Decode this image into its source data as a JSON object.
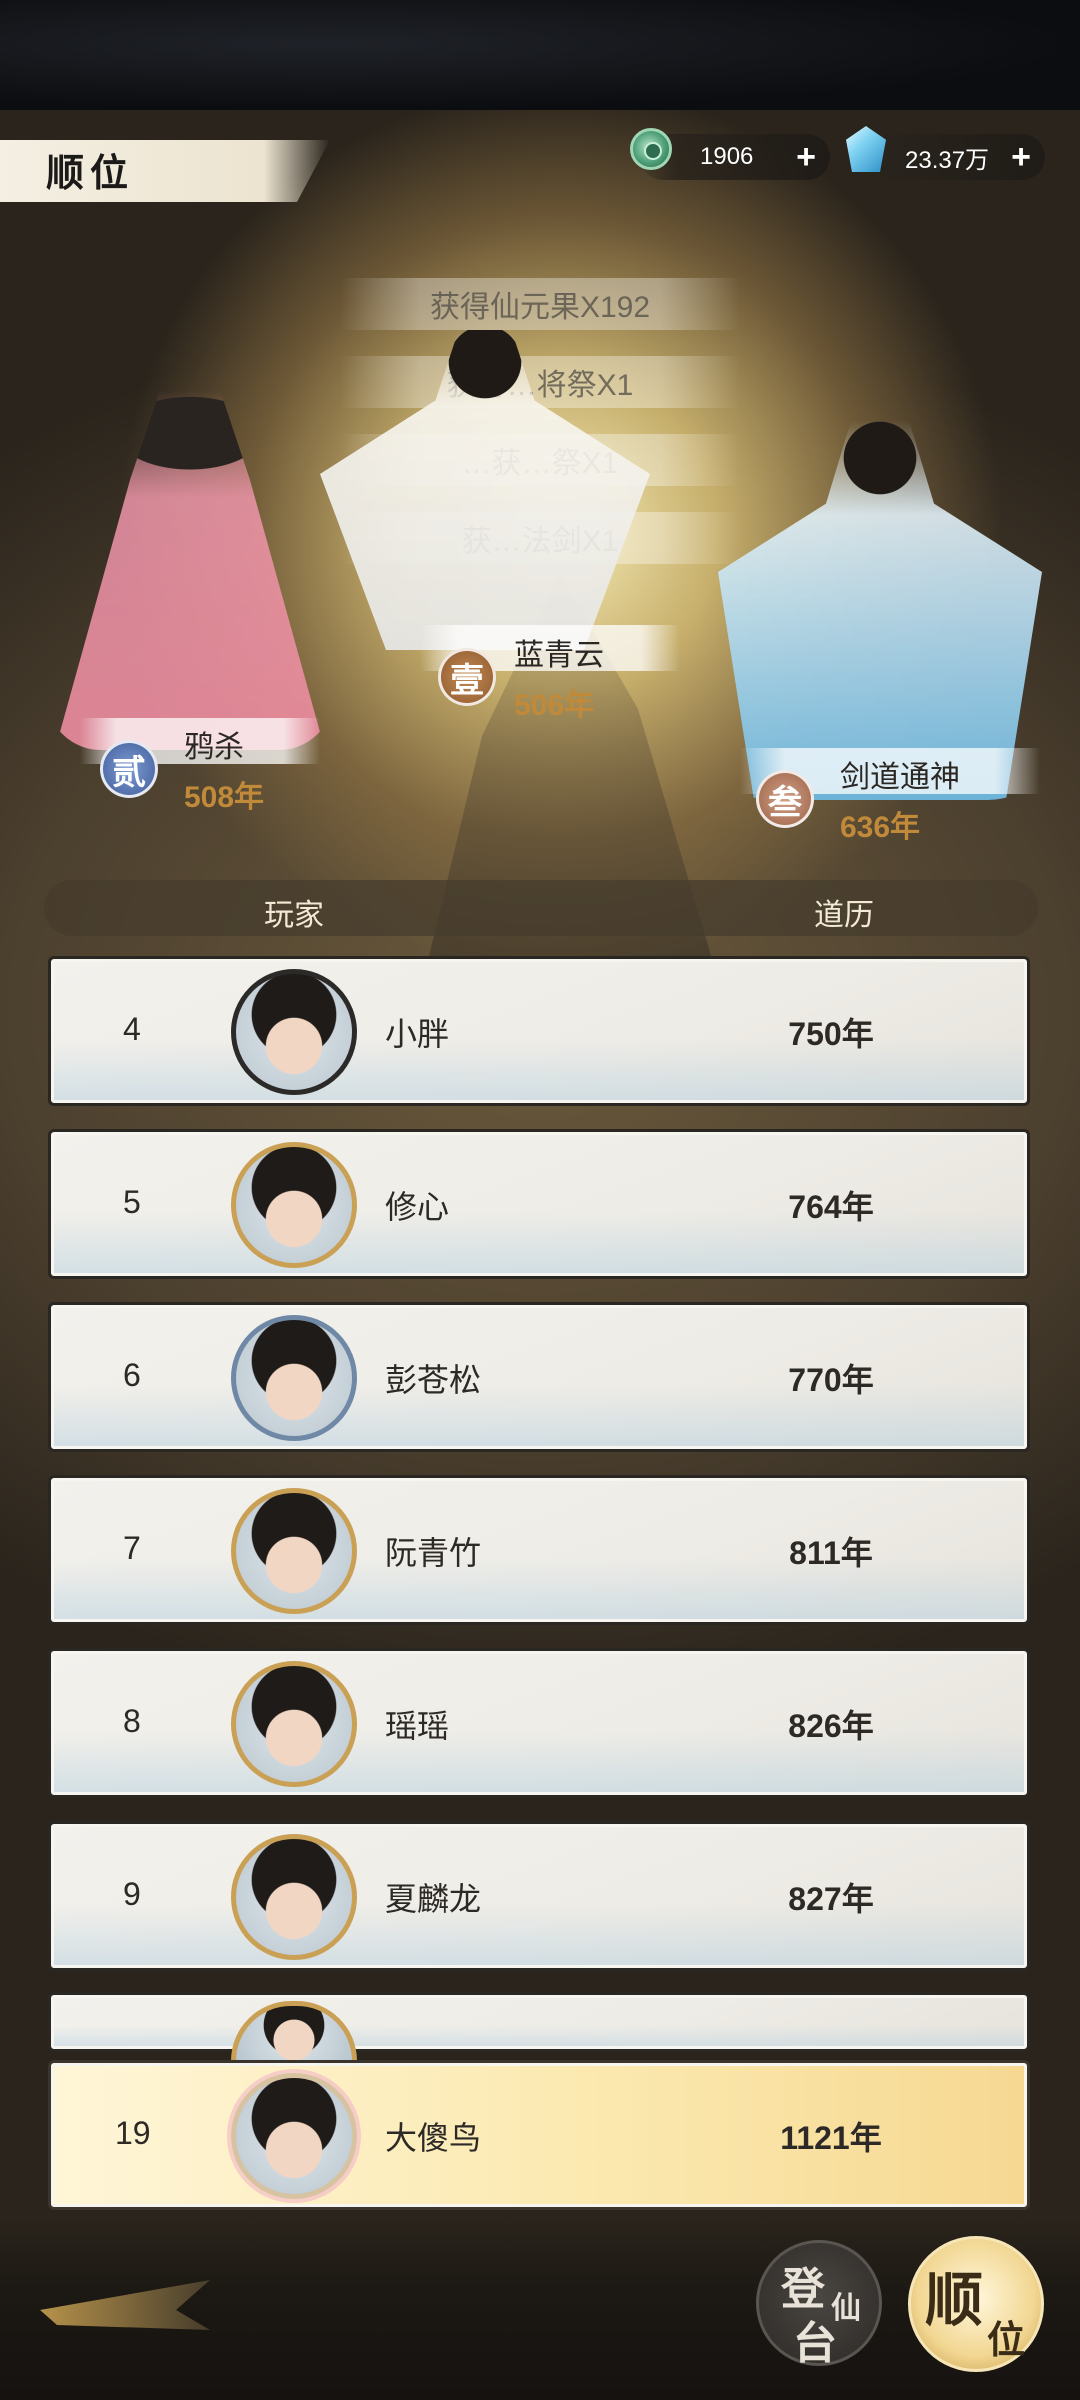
{
  "header": {
    "title": "顺位",
    "currency": [
      {
        "icon": "jade-coin-icon",
        "value": "1906",
        "plus": "+"
      },
      {
        "icon": "spirit-gem-icon",
        "value": "23.37万",
        "plus": "+"
      }
    ]
  },
  "rewards": [
    "获得仙元果X192",
    "获得…将祭X1",
    "…获…祭X1",
    "获…法剑X1"
  ],
  "podium": [
    {
      "rank_glyph": "贰",
      "name": "鸦杀",
      "years": "508年"
    },
    {
      "rank_glyph": "壹",
      "name": "蓝青云",
      "years": "506年"
    },
    {
      "rank_glyph": "叁",
      "name": "剑道通神",
      "years": "636年"
    }
  ],
  "table": {
    "headers": {
      "player": "玩家",
      "time": "道历"
    },
    "rows": [
      {
        "rank": "4",
        "name": "小胖",
        "years": "750年"
      },
      {
        "rank": "5",
        "name": "修心",
        "years": "764年"
      },
      {
        "rank": "6",
        "name": "彭苍松",
        "years": "770年"
      },
      {
        "rank": "7",
        "name": "阮青竹",
        "years": "811年"
      },
      {
        "rank": "8",
        "name": "瑶瑶",
        "years": "826年"
      },
      {
        "rank": "9",
        "name": "夏麟龙",
        "years": "827年"
      }
    ],
    "self": {
      "rank": "19",
      "name": "大傻鸟",
      "years": "1121年"
    }
  },
  "bottom_nav": {
    "dengxiantai": {
      "c1": "登",
      "c2": "仙",
      "c3": "台"
    },
    "shunwei": {
      "c1": "顺",
      "c2": "位"
    }
  }
}
